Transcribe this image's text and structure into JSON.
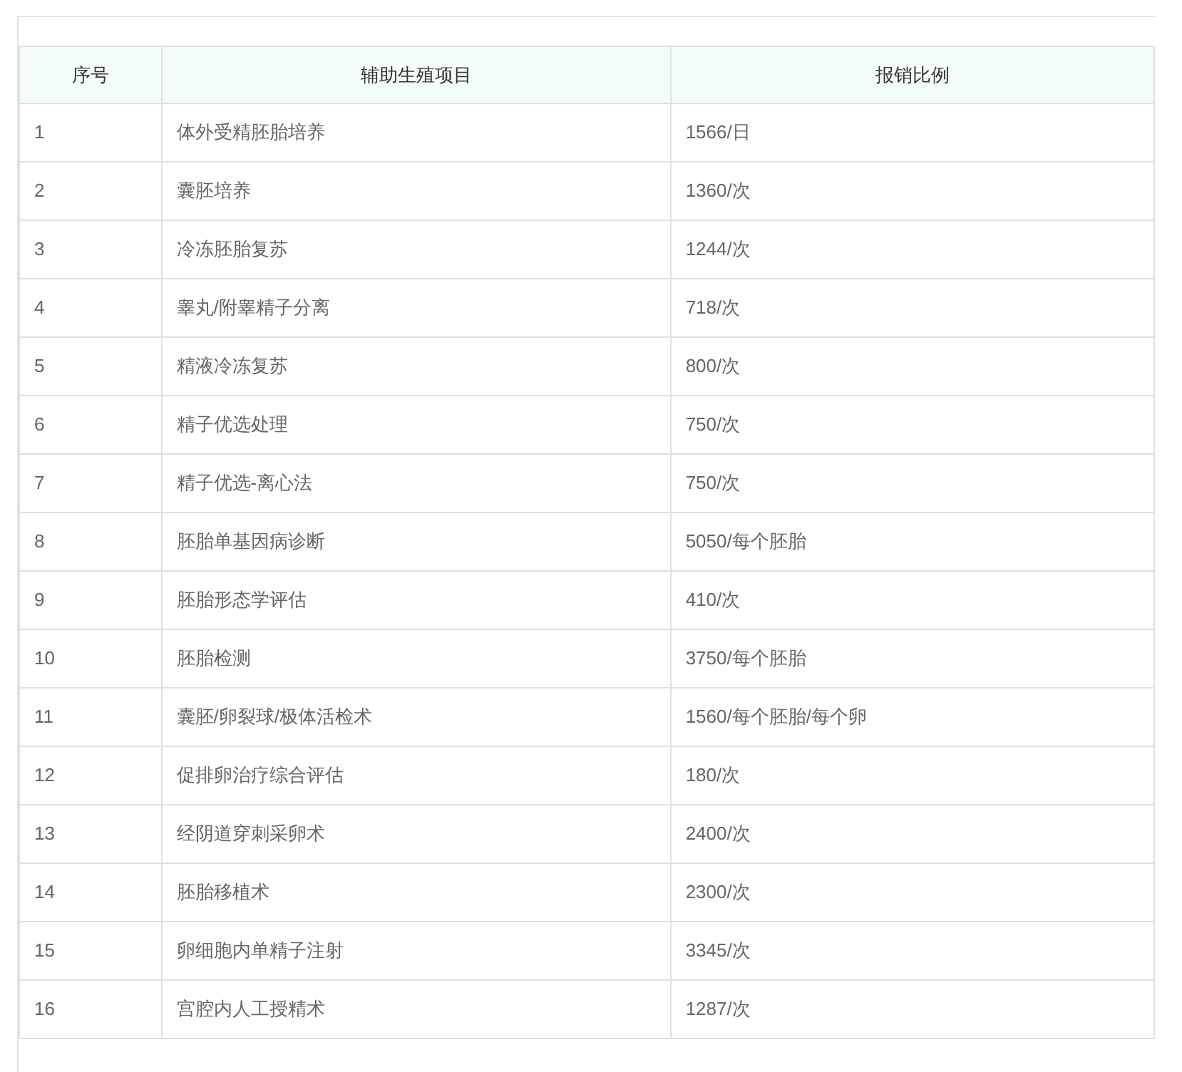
{
  "table": {
    "columns": [
      "序号",
      "辅助生殖项目",
      "报销比例"
    ],
    "rows": [
      [
        "1",
        "体外受精胚胎培养",
        "1566/日"
      ],
      [
        "2",
        "囊胚培养",
        "1360/次"
      ],
      [
        "3",
        "冷冻胚胎复苏",
        "1244/次"
      ],
      [
        "4",
        "睾丸/附睾精子分离",
        "718/次"
      ],
      [
        "5",
        "精液冷冻复苏",
        "800/次"
      ],
      [
        "6",
        "精子优选处理",
        "750/次"
      ],
      [
        "7",
        "精子优选-离心法",
        "750/次"
      ],
      [
        "8",
        "胚胎单基因病诊断",
        "5050/每个胚胎"
      ],
      [
        "9",
        "胚胎形态学评估",
        "410/次"
      ],
      [
        "10",
        "胚胎检测",
        "3750/每个胚胎"
      ],
      [
        "11",
        "囊胚/卵裂球/极体活检术",
        "1560/每个胚胎/每个卵"
      ],
      [
        "12",
        "促排卵治疗综合评估",
        "180/次"
      ],
      [
        "13",
        "经阴道穿刺采卵术",
        "2400/次"
      ],
      [
        "14",
        "胚胎移植术",
        "2300/次"
      ],
      [
        "15",
        "卵细胞内单精子注射",
        "3345/次"
      ],
      [
        "16",
        "宫腔内人工授精术",
        "1287/次"
      ]
    ]
  }
}
